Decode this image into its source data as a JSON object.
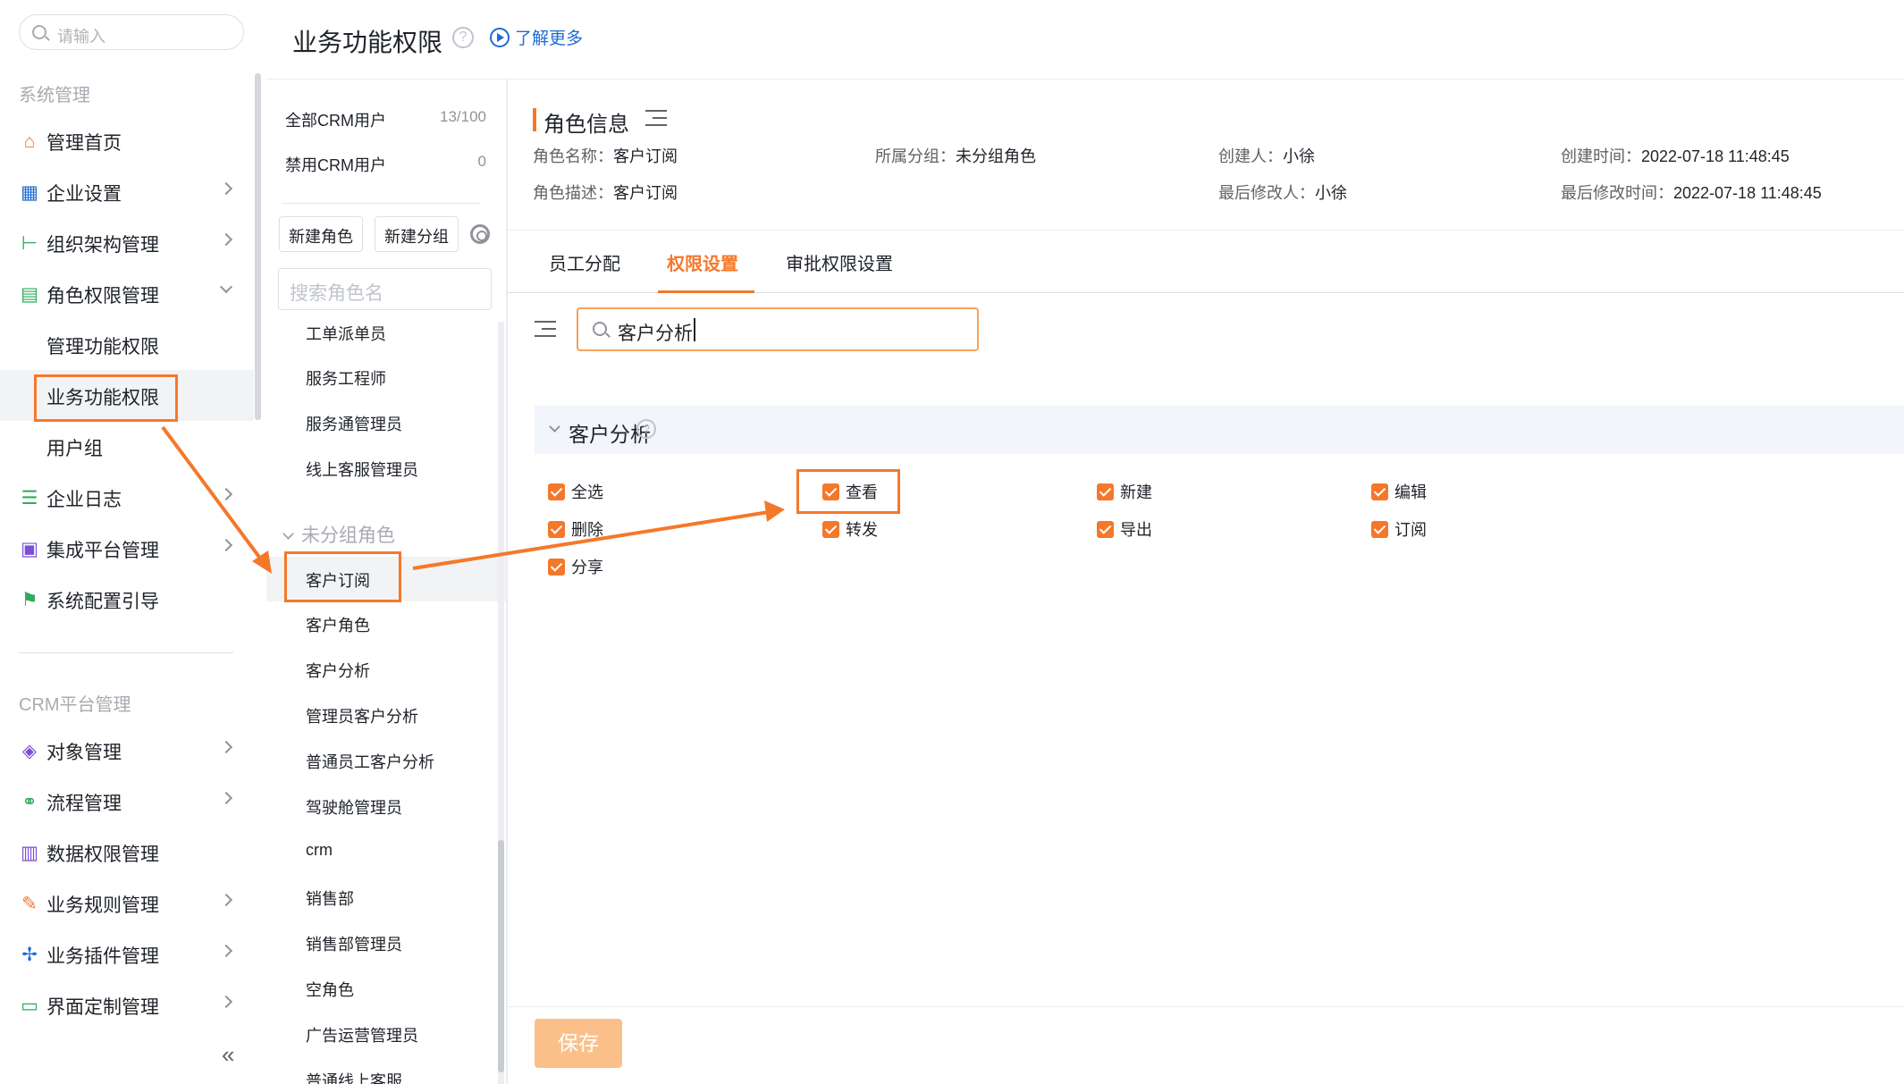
{
  "sidebar": {
    "search_placeholder": "请输入",
    "section_system": "系统管理",
    "items_system": [
      {
        "label": "管理首页",
        "icon": "home-icon",
        "color": "#f5782a",
        "chevron": false
      },
      {
        "label": "企业设置",
        "icon": "building-icon",
        "color": "#1e6bd6",
        "chevron": true
      },
      {
        "label": "组织架构管理",
        "icon": "org-tree-icon",
        "color": "#2faa5c",
        "chevron": true
      },
      {
        "label": "角色权限管理",
        "icon": "id-card-icon",
        "color": "#2faa5c",
        "chevron": "down"
      }
    ],
    "sub_items": [
      "管理功能权限",
      "业务功能权限",
      "用户组"
    ],
    "items_system2": [
      {
        "label": "企业日志",
        "icon": "log-icon",
        "color": "#2faa5c",
        "chevron": true
      },
      {
        "label": "集成平台管理",
        "icon": "chip-icon",
        "color": "#7b4fd6",
        "chevron": true
      },
      {
        "label": "系统配置引导",
        "icon": "guide-icon",
        "color": "#2faa5c",
        "chevron": false
      }
    ],
    "section_crm": "CRM平台管理",
    "items_crm": [
      {
        "label": "对象管理",
        "icon": "cube-icon",
        "color": "#7b4fd6",
        "chevron": true
      },
      {
        "label": "流程管理",
        "icon": "flow-icon",
        "color": "#2faa5c",
        "chevron": true
      },
      {
        "label": "数据权限管理",
        "icon": "data-lock-icon",
        "color": "#7b4fd6",
        "chevron": false
      },
      {
        "label": "业务规则管理",
        "icon": "wrench-icon",
        "color": "#f5782a",
        "chevron": true
      },
      {
        "label": "业务插件管理",
        "icon": "puzzle-icon",
        "color": "#1e6bd6",
        "chevron": true
      },
      {
        "label": "界面定制管理",
        "icon": "layout-icon",
        "color": "#2faa5c",
        "chevron": true
      }
    ],
    "collapse_glyph": "«"
  },
  "header": {
    "title": "业务功能权限",
    "help_glyph": "?",
    "learn_more": "了解更多"
  },
  "roles_panel": {
    "all_users_label": "全部CRM用户",
    "all_users_count": "13/100",
    "disabled_users_label": "禁用CRM用户",
    "disabled_users_count": "0",
    "new_role_button": "新建角色",
    "new_group_button": "新建分组",
    "search_placeholder": "搜索角色名",
    "roles_top": [
      "工单派单员",
      "服务工程师",
      "服务通管理员",
      "线上客服管理员"
    ],
    "group_label": "未分组角色",
    "roles_group": [
      "客户订阅",
      "客户角色",
      "客户分析",
      "管理员客户分析",
      "普通员工客户分析",
      "驾驶舱管理员",
      "crm",
      "销售部",
      "销售部管理员",
      "空角色",
      "广告运营管理员",
      "普通线上客服"
    ]
  },
  "role_info": {
    "title": "角色信息",
    "name_label": "角色名称：",
    "name_value": "客户订阅",
    "group_label": "所属分组：",
    "group_value": "未分组角色",
    "creator_label": "创建人：",
    "creator_value": "小徐",
    "created_label": "创建时间：",
    "created_value": "2022-07-18 11:48:45",
    "desc_label": "角色描述：",
    "desc_value": "客户订阅",
    "modifier_label": "最后修改人：",
    "modifier_value": "小徐",
    "modified_label": "最后修改时间：",
    "modified_value": "2022-07-18 11:48:45"
  },
  "tabs": [
    "员工分配",
    "权限设置",
    "审批权限设置"
  ],
  "active_tab": "权限设置",
  "permissions": {
    "search_value": "客户分析",
    "module_title": "客户分析",
    "items": [
      "全选",
      "查看",
      "新建",
      "编辑",
      "删除",
      "转发",
      "导出",
      "订阅",
      "分享"
    ]
  },
  "footer": {
    "save_button": "保存"
  },
  "colors": {
    "accent": "#f5782a",
    "link": "#1e6bd6",
    "save_disabled": "#fbc08a"
  }
}
